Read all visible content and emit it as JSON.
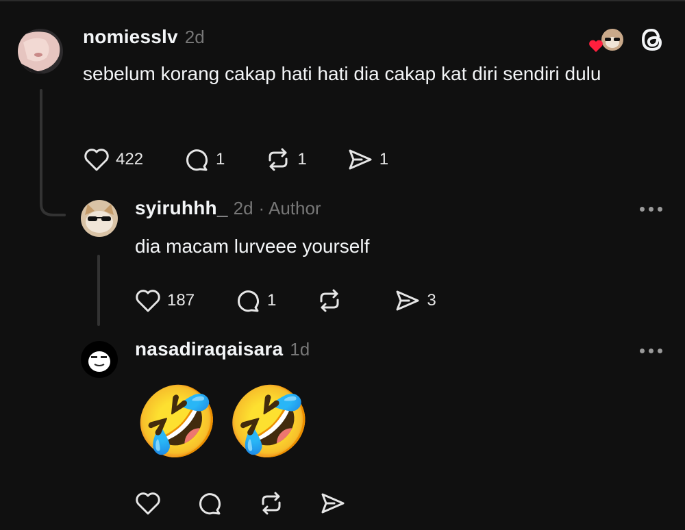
{
  "post": {
    "username": "nomiesslv",
    "time": "2d",
    "text": "sebelum korang cakap hati hati dia cakap kat diri sendiri dulu",
    "likes": "422",
    "replies": "1",
    "reposts": "1",
    "shares": "1"
  },
  "reply1": {
    "username": "syiruhhh_",
    "time": "2d",
    "badge": "· Author",
    "text": "dia macam lurveee yourself",
    "likes": "187",
    "replies": "1",
    "shares": "3"
  },
  "reply2": {
    "username": "nasadiraqaisara",
    "time": "1d",
    "text": "🤣🤣"
  },
  "icons": {
    "like": "heart-icon",
    "reply": "comment-icon",
    "repost": "repost-icon",
    "share": "send-icon",
    "brand": "threads-logo-icon"
  },
  "colors": {
    "background": "#101010",
    "text": "#f3f5f7",
    "muted": "#777777",
    "heart_badge": "#ff1f3d"
  }
}
